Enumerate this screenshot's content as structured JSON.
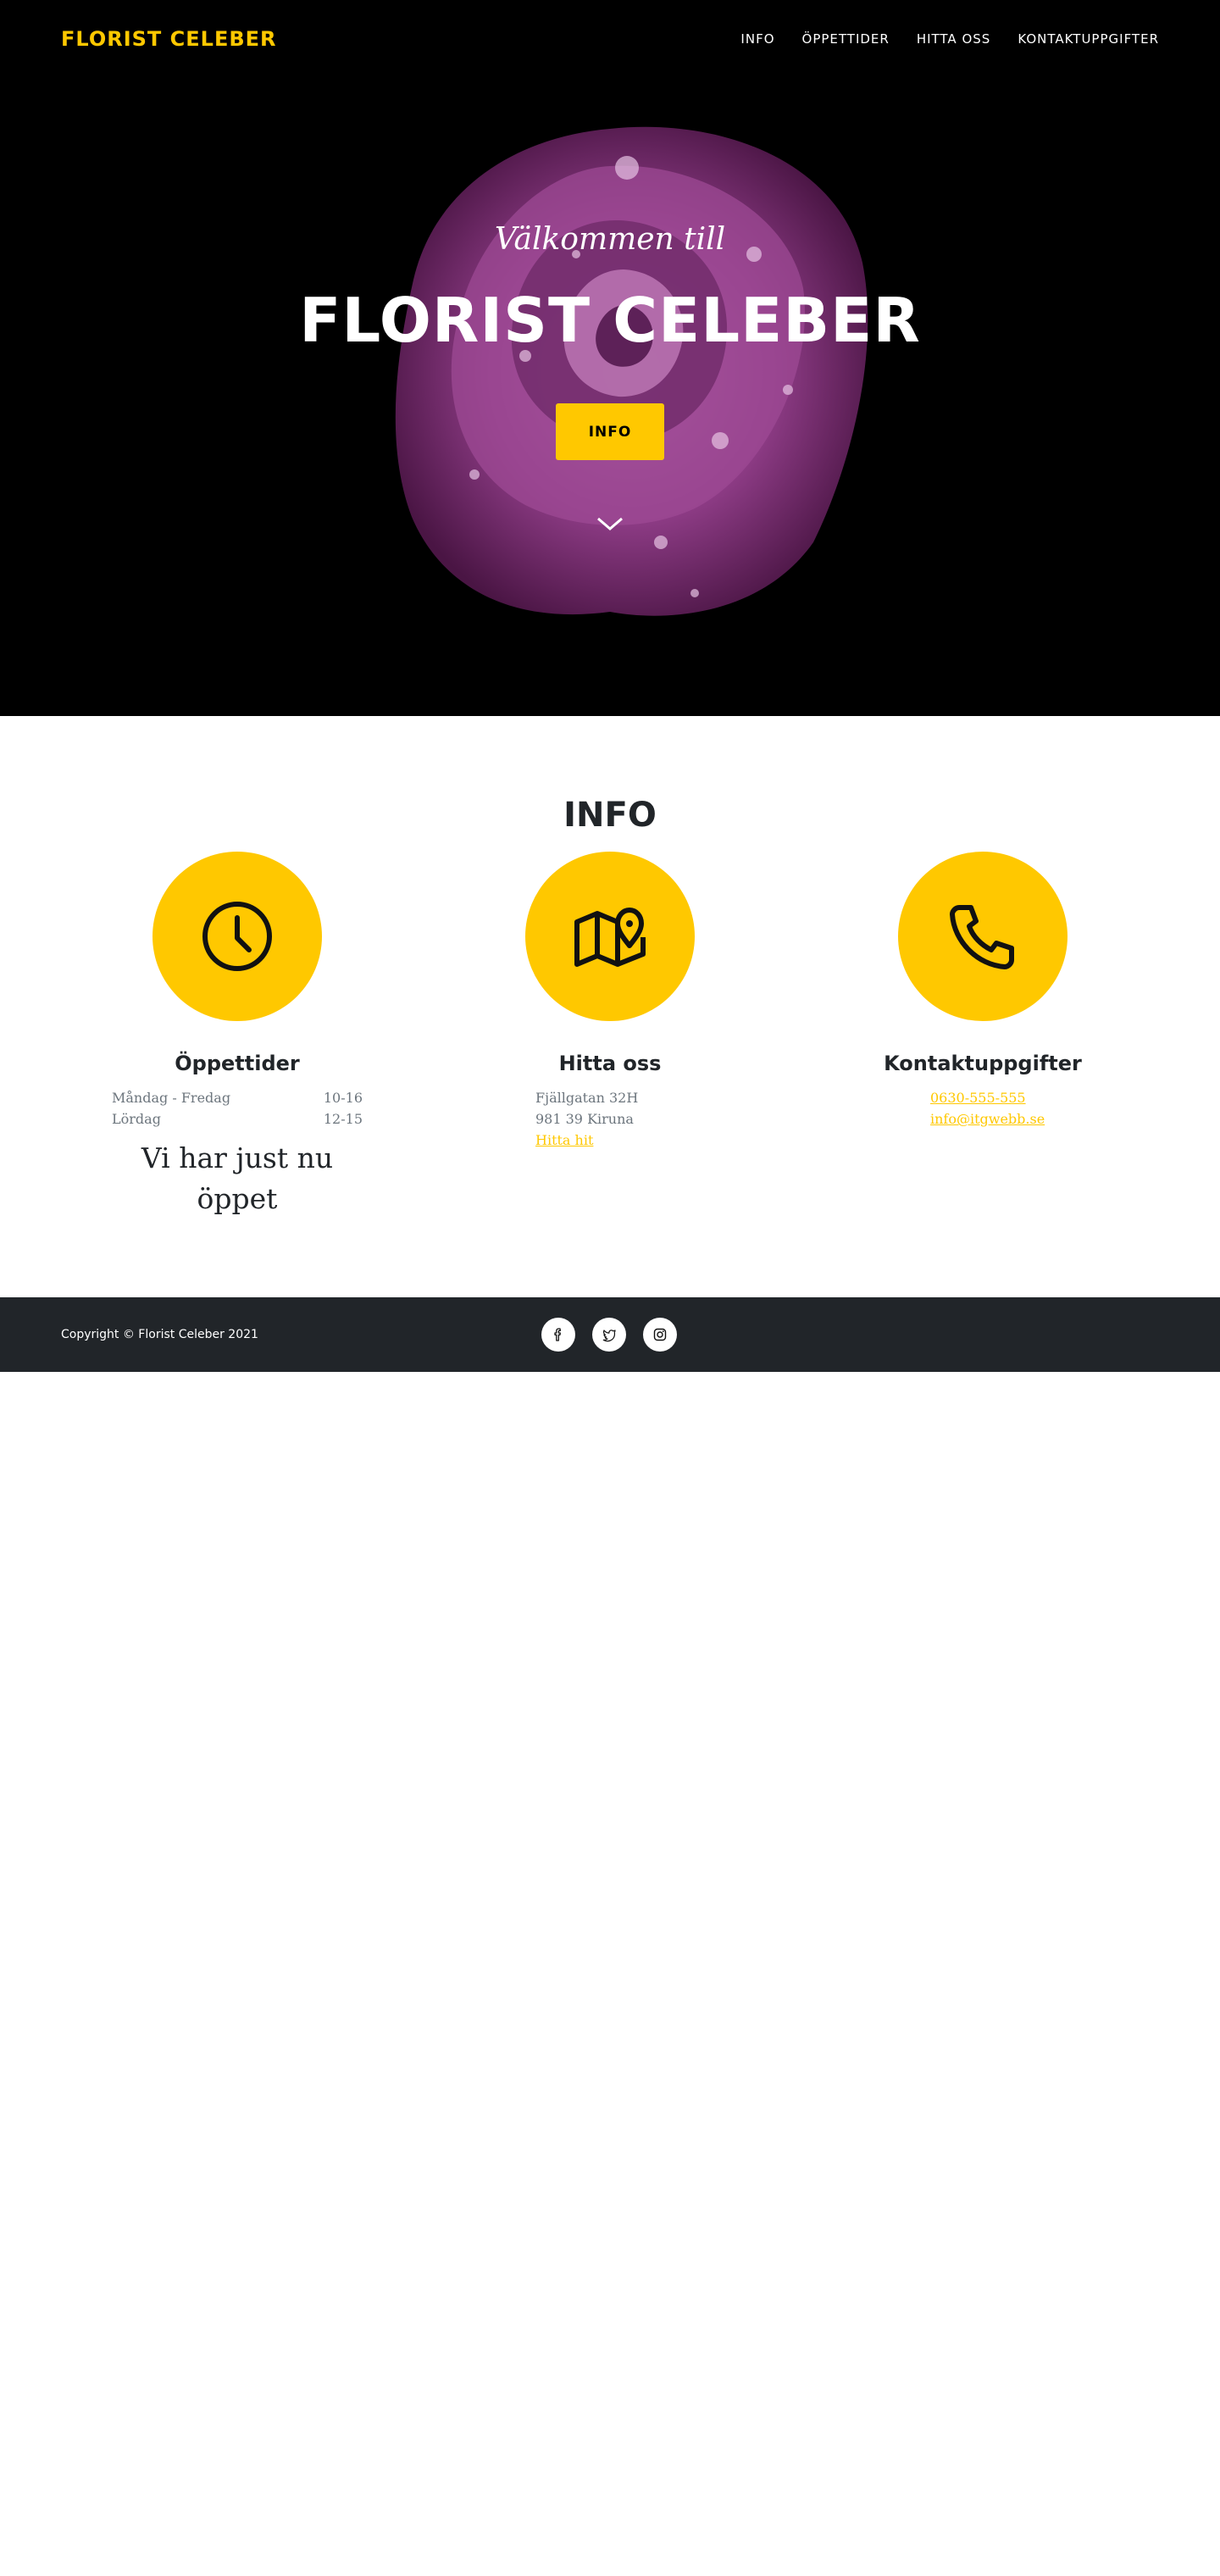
{
  "header": {
    "brand": "FLORIST CELEBER",
    "nav": [
      "INFO",
      "ÖPPETTIDER",
      "HITTA OSS",
      "KONTAKTUPPGIFTER"
    ]
  },
  "hero": {
    "subheading": "Välkommen till",
    "heading": "FLORIST CELEBER",
    "button_label": "INFO"
  },
  "info": {
    "title": "INFO",
    "hours": {
      "title": "Öppettider",
      "rows": [
        {
          "day": "Måndag - Fredag",
          "time": "10-16"
        },
        {
          "day": "Lördag",
          "time": "12-15"
        }
      ],
      "status": "Vi har just nu öppet"
    },
    "location": {
      "title": "Hitta oss",
      "street": "Fjällgatan 32H",
      "city": "981 39 Kiruna",
      "link": "Hitta hit"
    },
    "contact": {
      "title": "Kontaktuppgifter",
      "phone": "0630-555-555",
      "email": "info@itgwebb.se"
    }
  },
  "footer": {
    "copyright": "Copyright © Florist Celeber 2021",
    "social": [
      "facebook-icon",
      "twitter-icon",
      "instagram-icon"
    ]
  },
  "colors": {
    "accent": "#ffc800",
    "dark": "#212529",
    "muted": "#6c757d",
    "rose": "#8e3c86"
  }
}
